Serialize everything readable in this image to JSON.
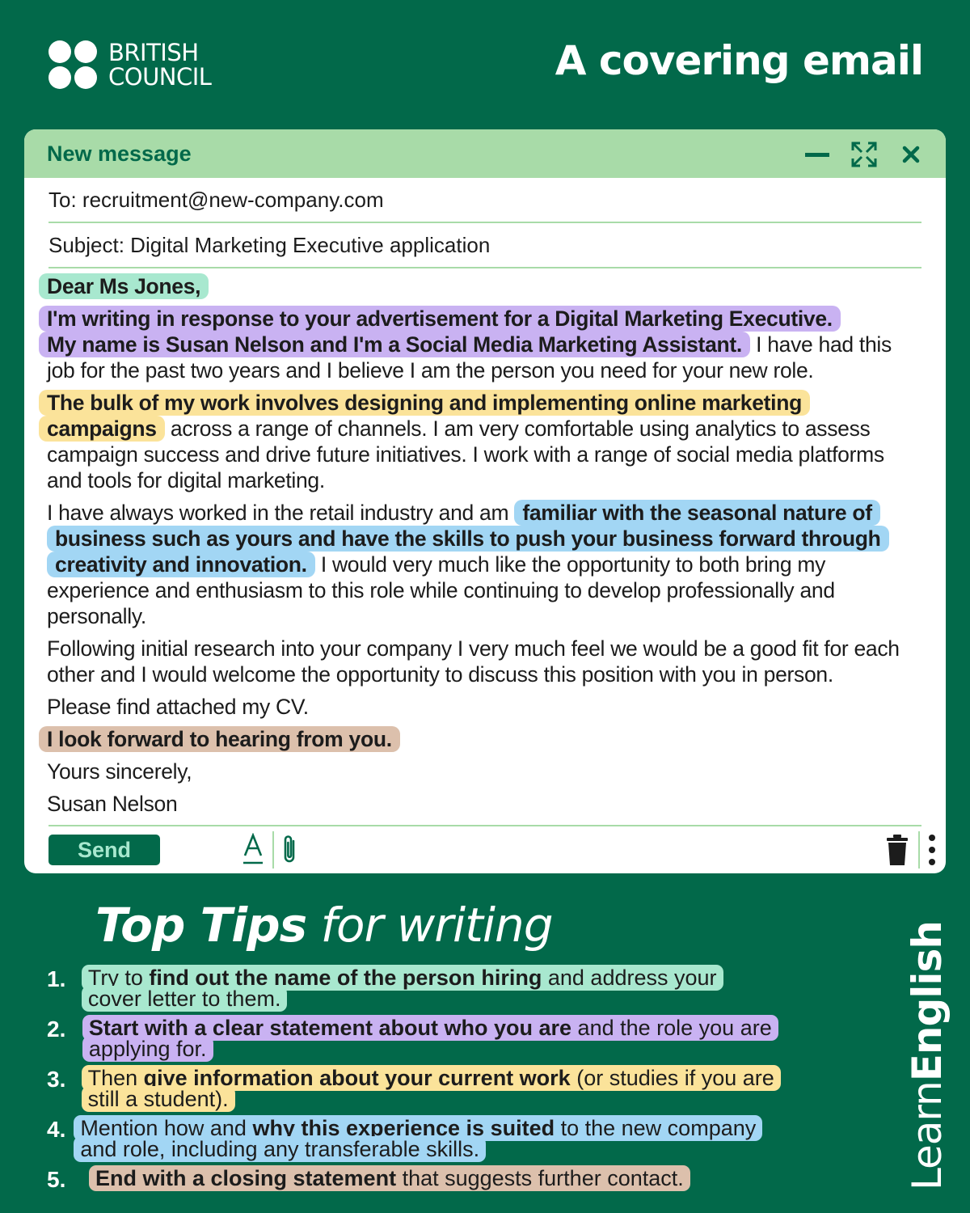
{
  "brand": {
    "logo_line1": "BRITISH",
    "logo_line2": "COUNCIL",
    "learn_part1": "Learn",
    "learn_part2": "English"
  },
  "page_title": "A covering email",
  "email": {
    "window_title": "New message",
    "to": "To: recruitment@new-company.com",
    "subject": "Subject: Digital Marketing Executive application",
    "greeting": "Dear Ms Jones,",
    "p1_hl1": "I'm writing in response to your advertisement for a Digital Marketing Executive.",
    "p1_hl2": "My name is Susan Nelson and I'm a Social Media Marketing Assistant.",
    "p1_rest": "I have had this job for the past two years and I believe I am the person you need for your new role.",
    "p2_hl": "The bulk of my work involves designing and implementing online marketing campaigns",
    "p2_rest": "across a range of channels. I am very comfortable using analytics to assess campaign success and drive future initiatives. I work with a range of social media platforms and tools for digital marketing.",
    "p3_pre": "I have always worked in the retail industry and am",
    "p3_hl": "familiar with the seasonal nature of business such as yours and have the skills to push your business forward through creativity and innovation.",
    "p3_rest": "I would very much like the opportunity to both bring my experience and enthusiasm to this role while continuing to develop professionally and personally.",
    "p4": "Following initial research into your company I very much feel we would be a good fit for each other and I would welcome the opportunity to discuss this position with you in person.",
    "p5": "Please find attached my CV.",
    "closing_hl": "I look forward to hearing from you.",
    "signoff": "Yours sincerely,",
    "signature": "Susan Nelson",
    "send_label": "Send"
  },
  "tips": {
    "title_bold": "Top Tips",
    "title_rest": " for writing",
    "items": [
      {
        "num": "1.",
        "a": "Try to ",
        "b": "find out the name of the person hiring",
        "c": " and address your cover letter to them."
      },
      {
        "num": "2.",
        "a": "",
        "b": "Start with a clear statement about who you are",
        "c": " and the role you are applying for."
      },
      {
        "num": "3.",
        "a": "Then ",
        "b": "give information about your current work",
        "c": " (or studies if you are still a student)."
      },
      {
        "num": "4.",
        "a": "Mention how and ",
        "b": "why this experience is suited",
        "c": " to the new company and role, including any transferable skills."
      },
      {
        "num": "5.",
        "a": "",
        "b": "End with a closing statement",
        "c": " that suggests further contact."
      }
    ]
  },
  "colors": {
    "background": "#02694a",
    "accent_light": "#a8dba8",
    "green_hl": "#a8e8cf",
    "purple_hl": "#c9b2f2",
    "yellow_hl": "#fbe39a",
    "blue_hl": "#a2d6f4",
    "tan_hl": "#dcc0ac"
  },
  "icons": [
    "minimize-icon",
    "expand-icon",
    "close-icon",
    "text-format-icon",
    "paperclip-icon",
    "trash-icon",
    "more-icon"
  ]
}
